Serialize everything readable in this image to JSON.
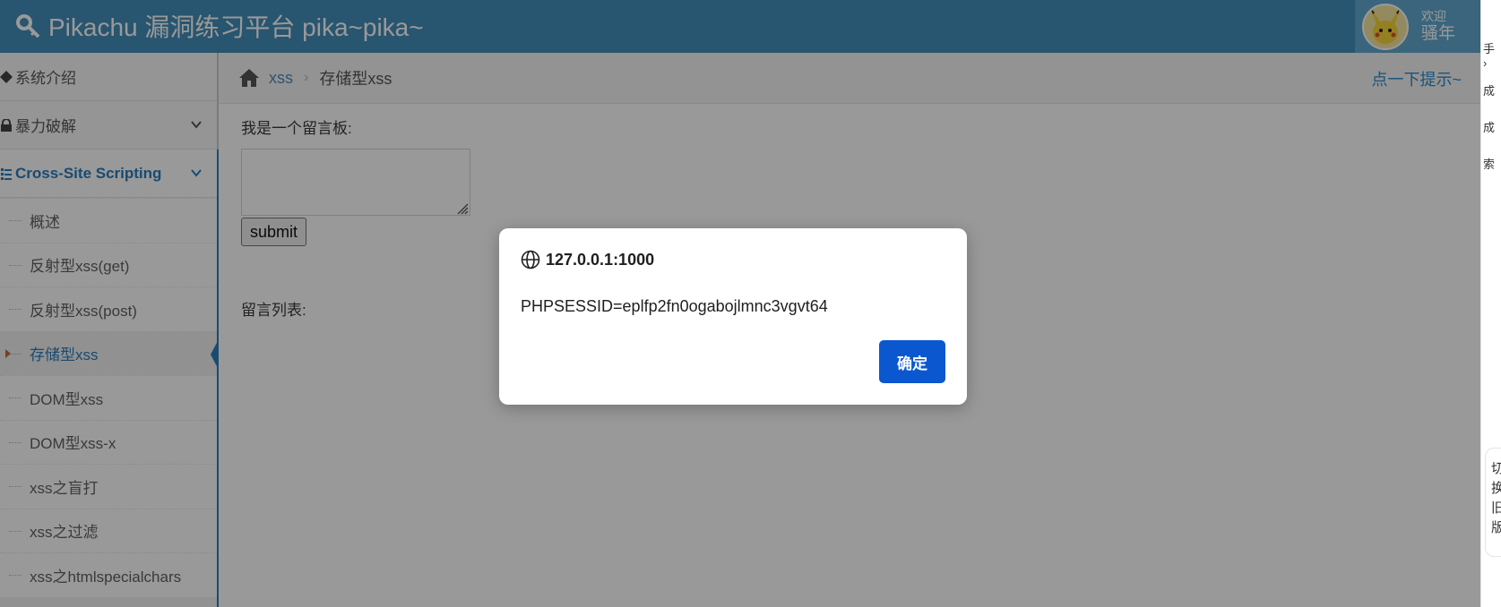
{
  "navbar": {
    "brand": "Pikachu 漏洞练习平台 pika~pika~",
    "welcome": "欢迎",
    "username": "骚年"
  },
  "sidebar": {
    "items": [
      {
        "label": "系统介绍",
        "icon": "diamond-icon"
      },
      {
        "label": "暴力破解",
        "icon": "lock-icon"
      },
      {
        "label": "Cross-Site Scripting",
        "icon": "list-icon"
      }
    ],
    "xss_submenu": [
      "概述",
      "反射型xss(get)",
      "反射型xss(post)",
      "存储型xss",
      "DOM型xss",
      "DOM型xss-x",
      "xss之盲打",
      "xss之过滤",
      "xss之htmlspecialchars"
    ],
    "active_index": 3
  },
  "breadcrumb": {
    "link": "xss",
    "separator": "›",
    "current": "存储型xss",
    "hint": "点一下提示~"
  },
  "main": {
    "board_label": "我是一个留言板:",
    "textarea_value": "",
    "submit_label": "submit",
    "list_label": "留言列表:"
  },
  "right_panel": {
    "items": [
      "手 ›",
      "成",
      "成",
      "索"
    ],
    "switch_text": "切换旧版"
  },
  "dialog": {
    "origin": "127.0.0.1:1000",
    "message": "PHPSESSID=eplfp2fn0ogabojlmnc3vgvt64",
    "ok_label": "确定"
  },
  "colors": {
    "navbar": "#438eb9",
    "accent": "#2b7dbc",
    "dialog_button": "#0b57d0"
  }
}
